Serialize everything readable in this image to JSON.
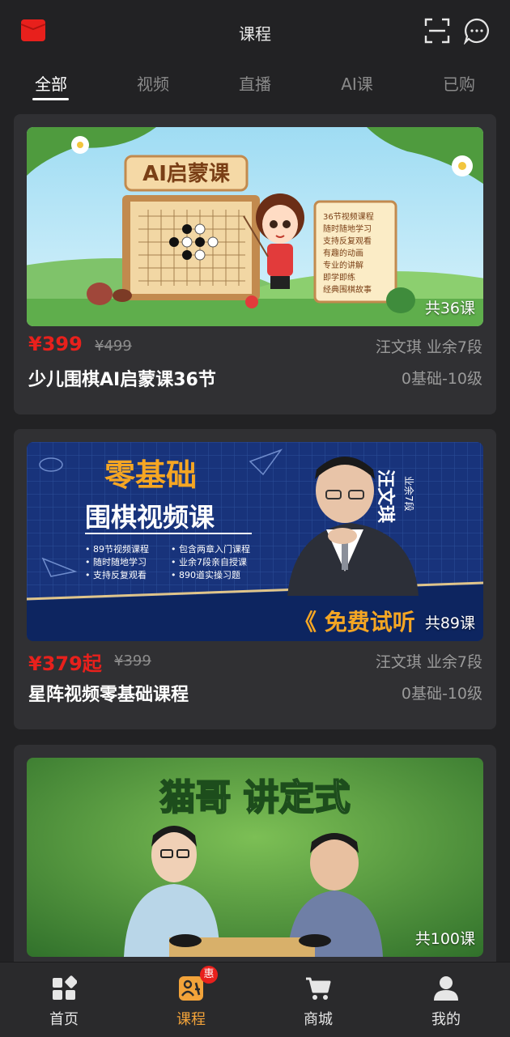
{
  "header": {
    "title": "课程"
  },
  "tabs": [
    {
      "label": "全部",
      "active": true
    },
    {
      "label": "视频"
    },
    {
      "label": "直播"
    },
    {
      "label": "AI课"
    },
    {
      "label": "已购"
    }
  ],
  "courses": [
    {
      "price": "¥399",
      "old_price": "¥499",
      "teacher": "汪文琪  业余7段",
      "name": "少儿围棋AI启蒙课36节",
      "level": "0基础-10级",
      "lesson_count": "共36课",
      "banner": {
        "title": "AI启蒙课",
        "features": [
          "36节视频课程",
          "随时随地学习",
          "支持反复观看",
          "有趣的动画",
          "专业的讲解",
          "即学即练",
          "经典围棋故事"
        ]
      }
    },
    {
      "price": "¥379起",
      "old_price": "¥399",
      "teacher": "汪文琪  业余7段",
      "name": "星阵视频零基础课程",
      "level": "0基础-10级",
      "lesson_count": "共89课",
      "banner": {
        "title_top": "零基础",
        "title_main": "围棋视频课",
        "features_left": [
          "• 89节视频课程",
          "• 随时随地学习",
          "• 支持反复观看"
        ],
        "features_right": [
          "• 包含两章入门课程",
          "• 业余7段亲自授课",
          "• 890道实操习题"
        ],
        "cta": "《 免费试听",
        "teacher_name": "汪文琪",
        "teacher_rank": "业余7段"
      }
    },
    {
      "lesson_count": "共100课",
      "banner": {
        "title": "猫哥  讲定式"
      }
    }
  ],
  "nav": [
    {
      "label": "首页",
      "icon": "home-icon"
    },
    {
      "label": "课程",
      "icon": "course-icon",
      "active": true,
      "badge": "惠"
    },
    {
      "label": "商城",
      "icon": "cart-icon"
    },
    {
      "label": "我的",
      "icon": "profile-icon"
    }
  ],
  "colors": {
    "background": "#222224",
    "card": "#303033",
    "price": "#e8201c",
    "accent": "#f2a33a"
  }
}
